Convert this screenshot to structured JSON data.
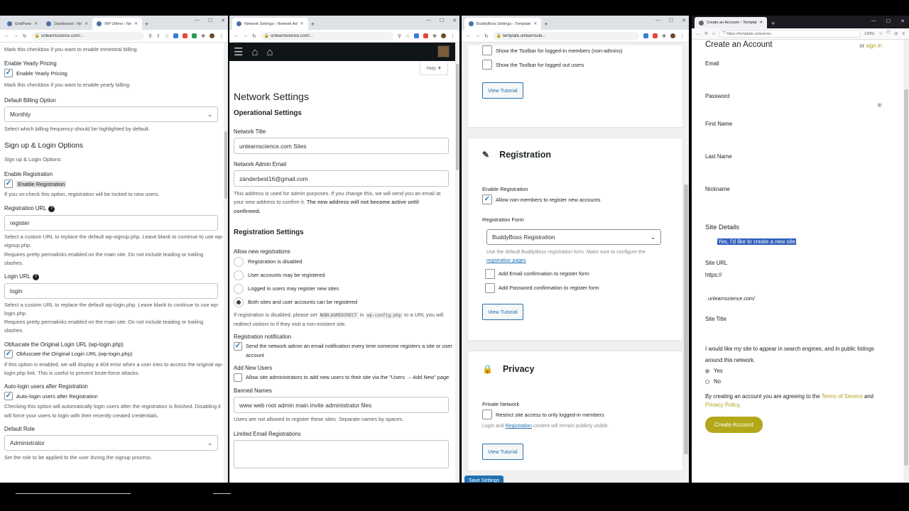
{
  "win1": {
    "tabs": [
      "GridPane",
      "Dashboard ‹ Ne",
      "WP Ultimo ‹ Ne"
    ],
    "url": "unlearnscience.com/...",
    "trimestral_hint": "Mark this checkbox if you want to enable trimestral billing.",
    "yearly_label": "Enable Yearly Pricing",
    "yearly_cb": "Enable Yearly Pricing",
    "yearly_hint": "Mark this checkbox if you want to enable yearly billing.",
    "billing_label": "Default Billing Option",
    "billing_value": "Monthly",
    "billing_hint": "Select which billing frequency should be highlighted by default.",
    "section_title": "Sign up & Login Options",
    "section_sub": "Sign up & Login Options",
    "reg_label": "Enable Registration",
    "reg_cb": "Enable Registration",
    "reg_hint": "If you un-check this option, registration will be locked to new users.",
    "regurl_label": "Registration URL",
    "regurl_value": "register",
    "regurl_hint1": "Select a custom URL to replace the default wp-signup.php. Leave blank to continue to use wp-signup.php.",
    "regurl_hint2": "Requires pretty permalinks enabled on the main site. Do not include leading or trailing slashes.",
    "login_label": "Login URL",
    "login_value": "login",
    "login_hint1": "Select a custom URL to replace the default wp-login.php. Leave blank to continue to use wp-login.php.",
    "login_hint2": "Requires pretty permalinks enabled on the main site. Do not include leading or trailing slashes.",
    "obf_label": "Obfuscate the Original Login URL (wp-login.php)",
    "obf_cb": "Obfuscate the Original Login URL (wp-login.php)",
    "obf_hint": "If this option is enabled, we will display a 404 error when a user tries to access the original wp-login.php link. This is useful to prevent brute-force attacks.",
    "auto_label": "Auto-login users after Registration",
    "auto_cb": "Auto-login users after Registration",
    "auto_hint": "Checking this option will automatically login users after the registration is finished. Disabling it will force your users to login with their recently created credentials.",
    "role_label": "Default Role",
    "role_value": "Administrator",
    "role_hint": "Set the role to be applied to the user during the signup process."
  },
  "win2": {
    "tab": "Network Settings ‹ Network Ad",
    "url": "unlearnscience.com/...",
    "help": "Help ▼",
    "title": "Network Settings",
    "op_title": "Operational Settings",
    "net_title_label": "Network Title",
    "net_title_value": "unlearnscience.com Sites",
    "email_label": "Network Admin Email",
    "email_value": "zanderbest16@gmail.com",
    "email_hint": "This address is used for admin purposes. If you change this, we will send you an email at your new address to confirm it.",
    "email_hint_bold": "The new address will not become active until confirmed.",
    "reg_title": "Registration Settings",
    "allow_label": "Allow new registrations",
    "radios": [
      "Registration is disabled",
      "User accounts may be registered",
      "Logged in users may register new sites",
      "Both sites and user accounts can be registered"
    ],
    "disabled_hint_a": "If registration is disabled, please set",
    "code1": "NOBLOGREDIRECT",
    "disabled_hint_b": "in",
    "code2": "wp-config.php",
    "disabled_hint_c": "to a URL you will redirect visitors to if they visit a non-existent site.",
    "notif_label": "Registration notification",
    "notif_cb": "Send the network admin an email notification every time someone registers a site or user account",
    "addnew_label": "Add New Users",
    "addnew_cb": "Allow site administrators to add new users to their site via the \"Users → Add New\" page",
    "banned_label": "Banned Names",
    "banned_value": "www web root admin main invite administrator files",
    "banned_hint": "Users are not allowed to register these sites. Separate names by spaces.",
    "limited_label": "Limited Email Registrations"
  },
  "win3": {
    "tab": "BuddyBoss Settings ‹ Template",
    "url": "template.unlearnscie...",
    "toolbar_members": "Show the Toolbar for logged-in members (non-admins)",
    "toolbar_out": "Show the Toolbar for logged out users",
    "tutorial": "View Tutorial",
    "reg_title": "Registration",
    "enable_label": "Enable Registration",
    "enable_cb": "Allow non-members to register new accounts",
    "form_label": "Registration Form",
    "form_value": "BuddyBoss Registration",
    "form_hint_a": "Use the default BuddyBoss registration form. Make sure to configure the",
    "form_hint_link": "registration pages",
    "email_conf": "Add Email confirmation to register form",
    "pass_conf": "Add Password confirmation to register form",
    "privacy_title": "Privacy",
    "private_label": "Private Network",
    "private_cb": "Restrict site access to only logged-in members",
    "private_hint_a": "Login and",
    "private_hint_link": "Registration",
    "private_hint_b": "content will remain publicly visible.",
    "save": "Save Settings"
  },
  "win4": {
    "tab": "Create an Account – Templat",
    "url": "https://template.unlearnsc",
    "zoom": "120%",
    "title": "Create an Account",
    "or": "or",
    "signin": "sign in",
    "email": "Email",
    "password": "Password",
    "first": "First Name",
    "last": "Last Name",
    "nickname": "Nickname",
    "site_details": "Site Details",
    "create_site": "Yes, I'd like to create a new site",
    "site_url": "Site URL",
    "https": "https://",
    "domain": ". unlearnscience.com/",
    "site_title": "Site Title",
    "search_text": "I would like my site to appear in search engines, and in public listings around this network.",
    "yes": "Yes",
    "no": "No",
    "terms_a": "By creating an account you are agreeing to the",
    "terms": "Terms of Service",
    "and": "and",
    "privacy": "Privacy Policy",
    "create_btn": "Create Account"
  }
}
